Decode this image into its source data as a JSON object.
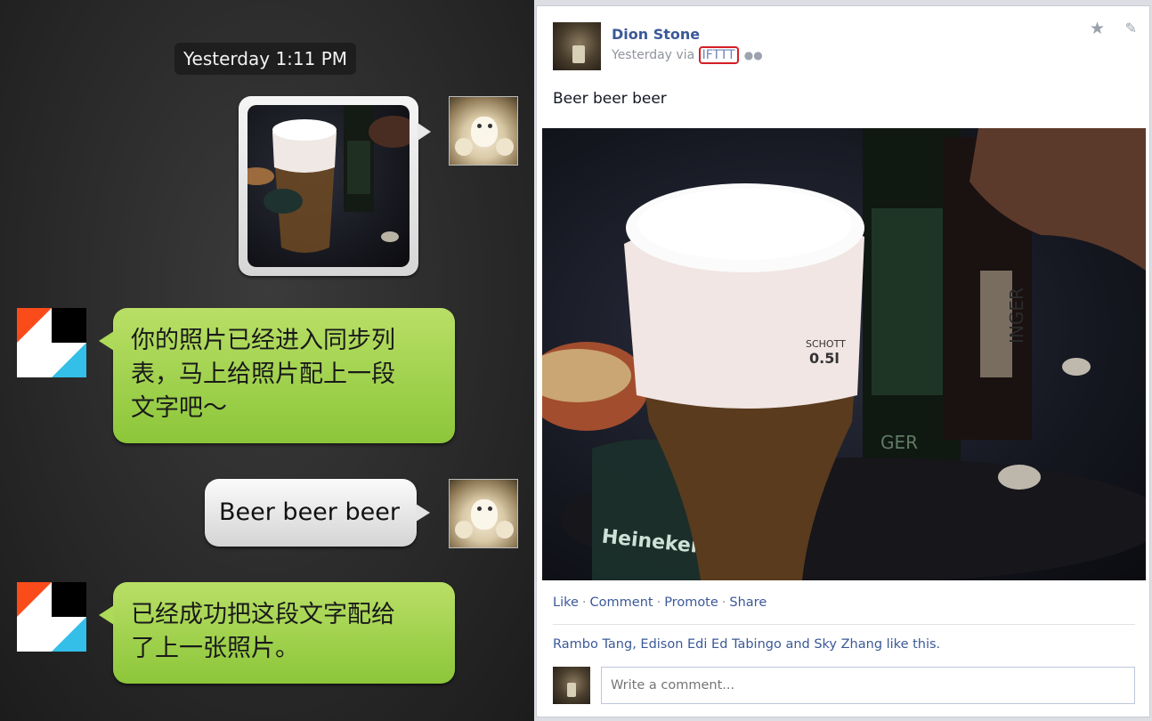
{
  "chat": {
    "timestamp": "Yesterday 1:11 PM",
    "messages": [
      {
        "from": "user",
        "kind": "photo"
      },
      {
        "from": "ifttt",
        "text_lines": [
          "你的照片已经进入同步列",
          "表，马上给照片配上一段",
          "文字吧～"
        ]
      },
      {
        "from": "user",
        "text": "Beer beer beer"
      },
      {
        "from": "ifttt",
        "text_lines": [
          "已经成功把这段文字配给",
          "了上一张照片。"
        ]
      }
    ]
  },
  "facebook": {
    "author": "Dion Stone",
    "meta_prefix": "Yesterday via ",
    "via_app": "IFTTT",
    "status": "Beer beer beer",
    "actions": [
      "Like",
      "Comment",
      "Promote",
      "Share"
    ],
    "action_separator": "·",
    "likes_text": "Rambo Tang, Edison Edi Ed Tabingo and Sky Zhang like this.",
    "comment_placeholder": "Write a comment...",
    "icons": {
      "star": "star-icon",
      "edit": "pencil-icon",
      "audience": "friends-icon"
    }
  },
  "photo": {
    "glass_text_1": "SCHOTT",
    "glass_text_2": "0.5l",
    "bottle_label": "INGER",
    "bottle_label_2": "GER",
    "glass_logo": "Heineken"
  },
  "colors": {
    "fb_link": "#3b5998",
    "ifttt_red": "#fa4b1b",
    "ifttt_black": "#000000",
    "ifttt_blue": "#33bfe8",
    "bubble_green": "#9fd44e",
    "highlight_red": "#d31f25"
  }
}
